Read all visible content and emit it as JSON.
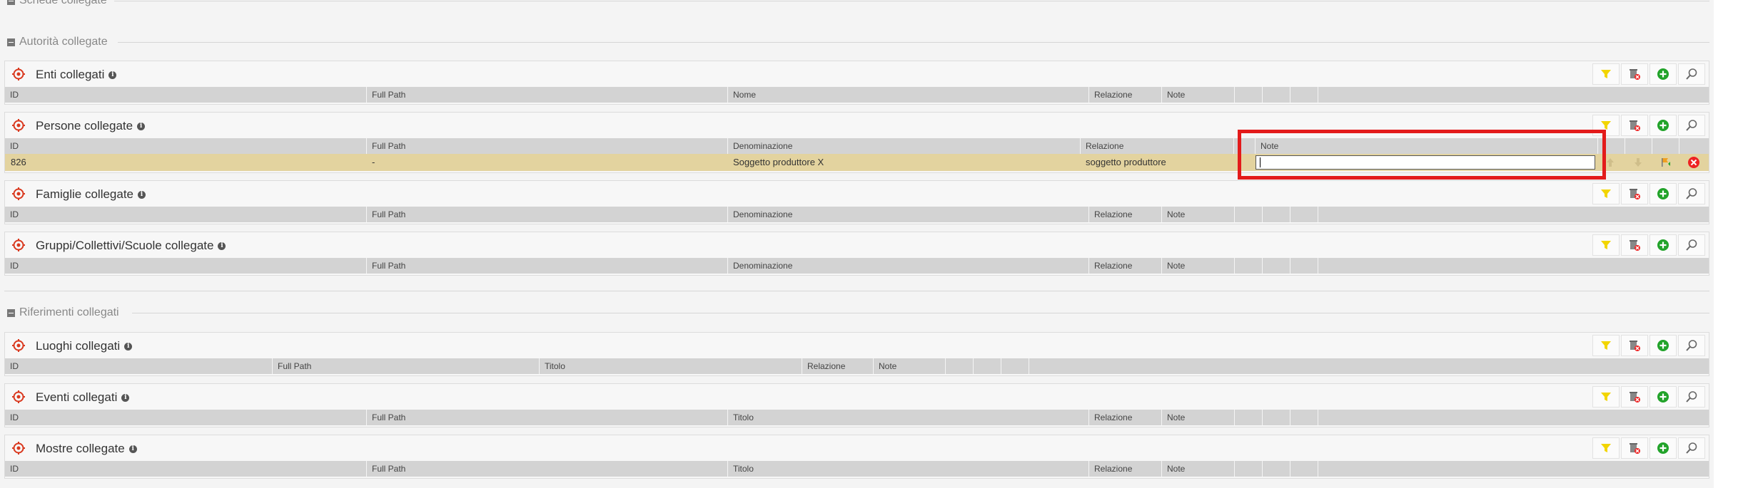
{
  "sections": {
    "schede": "Schede collegate",
    "autorita": "Autorità collegate",
    "riferimenti": "Riferimenti collegati"
  },
  "panels": [
    {
      "title": "Enti collegati",
      "columns": [
        "ID",
        "Full Path",
        "Nome",
        "Relazione",
        "Note",
        "",
        "",
        ""
      ]
    },
    {
      "title": "Persone collegate",
      "columns": [
        "ID",
        "Full Path",
        "Denominazione",
        "Relazione",
        "",
        "Note",
        "",
        "",
        "",
        ""
      ],
      "row": {
        "id": "826",
        "full_path": "-",
        "denominazione": "Soggetto produttore X",
        "relazione": "soggetto produttore",
        "note_value": ""
      }
    },
    {
      "title": "Famiglie collegate",
      "columns": [
        "ID",
        "Full Path",
        "Denominazione",
        "Relazione",
        "Note",
        "",
        "",
        ""
      ]
    },
    {
      "title": "Gruppi/Collettivi/Scuole collegate",
      "columns": [
        "ID",
        "Full Path",
        "Denominazione",
        "Relazione",
        "Note",
        "",
        "",
        ""
      ]
    },
    {
      "title": "Luoghi collegati",
      "columns": [
        "ID",
        "Full Path",
        "Titolo",
        "Relazione",
        "Note",
        "",
        "",
        ""
      ]
    },
    {
      "title": "Eventi collegati",
      "columns": [
        "ID",
        "Full Path",
        "Titolo",
        "Relazione",
        "Note",
        "",
        "",
        ""
      ]
    },
    {
      "title": "Mostre collegate",
      "columns": [
        "ID",
        "Full Path",
        "Titolo",
        "Relazione",
        "Note",
        "",
        "",
        ""
      ]
    }
  ],
  "icons": {
    "target": "target-icon",
    "info": "info-icon",
    "filter": "filter-icon",
    "delete_all": "trash-delete-icon",
    "add": "add-icon",
    "search": "search-icon",
    "move_up": "arrow-up-icon",
    "move_down": "arrow-down-icon",
    "flag": "flag-icon",
    "remove": "remove-icon"
  },
  "colors": {
    "accent_red": "#e31b1b",
    "row_highlight": "#e3d39f",
    "header_gray": "#d3d3d3",
    "filter_yellow": "#f2d500",
    "add_green": "#22a32a"
  }
}
